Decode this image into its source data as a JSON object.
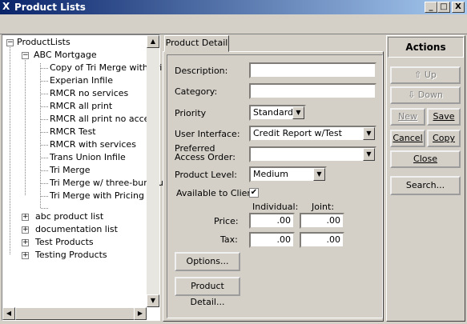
{
  "window": {
    "title": "Product Lists",
    "controls": [
      "_",
      "□",
      "X"
    ]
  },
  "tree": {
    "root": "ProductLists",
    "groups": [
      {
        "label": "ABC Mortgage",
        "expanded": true,
        "items": [
          "Copy of Tri Merge with Pri",
          "Experian Infile",
          "RMCR  no services",
          "RMCR all print",
          "RMCR all print no access",
          "RMCR Test",
          "RMCR with services",
          "Trans Union Infile",
          "Tri Merge",
          "Tri Merge w/ three-bureau",
          "Tri Merge with Pricing"
        ]
      },
      {
        "label": "abc product list",
        "expanded": false
      },
      {
        "label": "documentation list",
        "expanded": false
      },
      {
        "label": "Test Products",
        "expanded": false
      },
      {
        "label": "Testing Products",
        "expanded": false
      }
    ]
  },
  "tab": {
    "label": "Product Detail"
  },
  "form": {
    "description_label": "Description:",
    "description_value": "",
    "category_label": "Category:",
    "category_value": "",
    "priority_label": "Priority",
    "priority_value": "Standard",
    "ui_label": "User Interface:",
    "ui_value": "Credit Report w/Test",
    "access_label_1": "Preferred",
    "access_label_2": "Access Order:",
    "access_value": "",
    "level_label": "Product Level:",
    "level_value": "Medium",
    "available_label": "Available to Client:",
    "available_checked": true,
    "checkmark": "✔",
    "individual_header": "Individual:",
    "joint_header": "Joint:",
    "price_label": "Price:",
    "price_individual": ".00",
    "price_joint": ".00",
    "tax_label": "Tax:",
    "tax_individual": ".00",
    "tax_joint": ".00",
    "options_button": "Options...",
    "product_detail_button": "Product Detail..."
  },
  "actions": {
    "header": "Actions",
    "up": "Up",
    "down": "Down",
    "new": "New",
    "save": "Save",
    "cancel": "Cancel",
    "copy": "Copy",
    "close": "Close",
    "search": "Search..."
  }
}
